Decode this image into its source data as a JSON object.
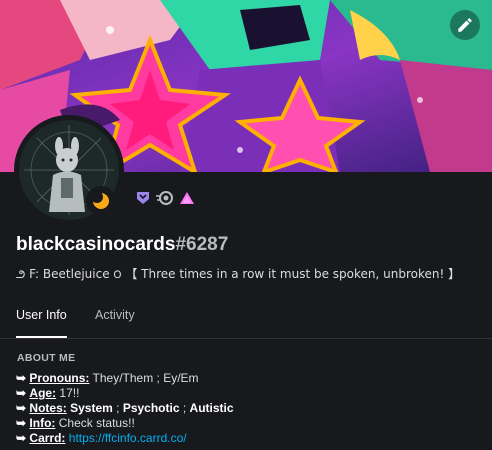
{
  "user": {
    "name": "blackcasinocards",
    "discriminator": "#6287"
  },
  "custom_status": "౨ F: Beetlejuice ౦ 【 Three times in a row it must be spoken, unbroken! 】",
  "tabs": [
    {
      "label": "User Info",
      "active": true
    },
    {
      "label": "Activity",
      "active": false
    }
  ],
  "about": {
    "title": "ABOUT ME",
    "bullet": "➥",
    "rows": [
      {
        "key": "Pronouns:",
        "value": " They/Them ; Ey/Em"
      },
      {
        "key": "Age:",
        "value": " 17!!"
      },
      {
        "key": "Notes:",
        "k2": "System",
        "sep1": " ; ",
        "k3": "Psychotic",
        "sep2": " ; ",
        "k4": "Autistic"
      },
      {
        "key": "Info:",
        "value": " Check status!!"
      },
      {
        "key": "Carrd:",
        "link": "https://ffcinfo.carrd.co/"
      }
    ]
  },
  "icons": {
    "edit": "pencil-icon",
    "status": "idle-moon-icon",
    "badges": [
      "hypesquad-icon",
      "nitro-icon",
      "boost-icon"
    ]
  },
  "colors": {
    "background": "#18191c",
    "link": "#00b0f4",
    "idle": "#faa81a",
    "badge_purple": "#9b84ec",
    "boost_pink": "#ff73fa"
  }
}
